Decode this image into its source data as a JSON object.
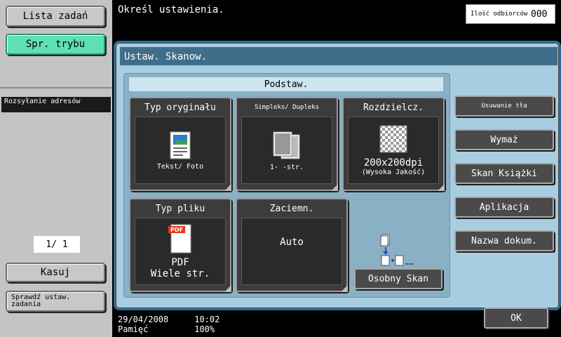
{
  "left_panel": {
    "job_list_label": "Lista zadań",
    "mode_check_label": "Spr. trybu",
    "address_broadcast_label": "Rozsyłanie adresów",
    "page_counter": "1/  1",
    "delete_label": "Kasuj",
    "check_job_settings_label": "Sprawdź ustaw. zadania"
  },
  "header": {
    "message": "Określ ustawienia.",
    "recipients_label": "Ilość odbiorców",
    "recipients_count": "000"
  },
  "panel": {
    "title": "Ustaw. Skanow.",
    "group_title": "Podstaw.",
    "tiles": [
      {
        "title": "Typ oryginału",
        "value": "Tekst/ Foto",
        "icon": "text-photo-icon"
      },
      {
        "title": "Simpleks/ Dupleks",
        "value": "1- -str.",
        "icon": "simplex-duplex-icon"
      },
      {
        "title": "Rozdzielcz.",
        "value": "200x200dpi",
        "sub": "(Wysoka Jakość)",
        "icon": "resolution-icon"
      },
      {
        "title": "Typ pliku",
        "value": "PDF",
        "value2": "Wiele str.",
        "icon": "pdf-file-icon",
        "icon_text": "PDF"
      },
      {
        "title": "Zaciemn.",
        "value": "Auto"
      }
    ],
    "separate_scan_label": "Osobny Skan",
    "side_buttons": [
      "Usuwanie tła",
      "Wymaż",
      "Skan Książki",
      "Aplikacja",
      "Nazwa dokum."
    ],
    "ok_label": "OK"
  },
  "status": {
    "date": "29/04/2008",
    "time": "10:02",
    "memory_label": "Pamięć",
    "memory_value": "100%"
  },
  "colors": {
    "accent_green": "#5ee0b4",
    "panel_blue": "#a8cde0",
    "title_blue": "#3f6d8a"
  }
}
